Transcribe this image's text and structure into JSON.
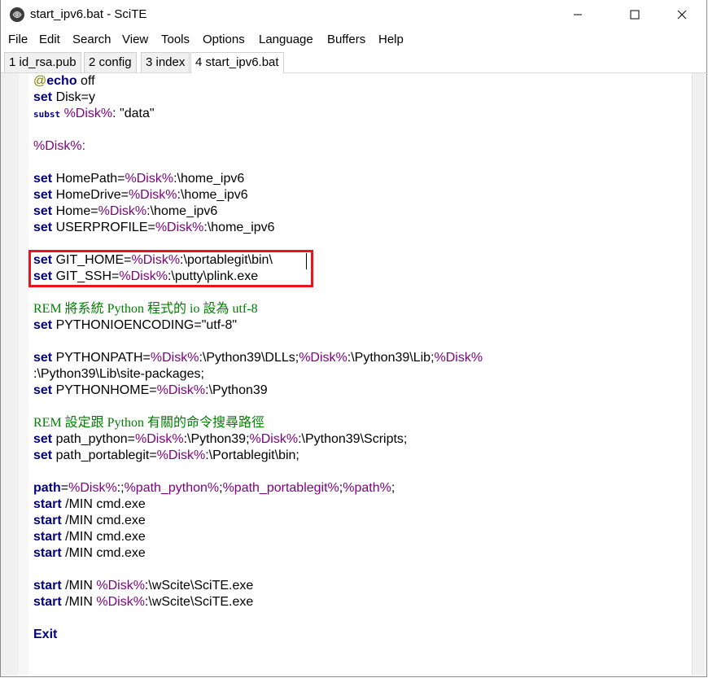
{
  "window": {
    "title": "start_ipv6.bat - SciTE",
    "controls": [
      "minimize-icon",
      "maximize-icon",
      "close-icon"
    ]
  },
  "menu": [
    "File",
    "Edit",
    "Search",
    "View",
    "Tools",
    "Options",
    "Language",
    "Buffers",
    "Help"
  ],
  "tabs": [
    {
      "label": "1 id_rsa.pub",
      "active": false
    },
    {
      "label": "2 config",
      "active": false
    },
    {
      "label": "3 index",
      "active": false
    },
    {
      "label": "4 start_ipv6.bat",
      "active": true
    }
  ],
  "editor": {
    "lines": [
      [
        {
          "t": "@",
          "c": "at"
        },
        {
          "t": "echo",
          "c": "kw"
        },
        {
          "t": " off",
          "c": ""
        }
      ],
      [
        {
          "t": "set",
          "c": "kw"
        },
        {
          "t": " Disk=y",
          "c": ""
        }
      ],
      [
        {
          "t": "subst",
          "c": "small-kw"
        },
        {
          "t": " ",
          "c": ""
        },
        {
          "t": "%Disk%",
          "c": "var"
        },
        {
          "t": ": \"data\"",
          "c": ""
        }
      ],
      [],
      [
        {
          "t": "%Disk%:",
          "c": "var"
        }
      ],
      [],
      [
        {
          "t": "set",
          "c": "kw"
        },
        {
          "t": " HomePath=",
          "c": ""
        },
        {
          "t": "%Disk%",
          "c": "var"
        },
        {
          "t": ":\\home_ipv6",
          "c": ""
        }
      ],
      [
        {
          "t": "set",
          "c": "kw"
        },
        {
          "t": " HomeDrive=",
          "c": ""
        },
        {
          "t": "%Disk%",
          "c": "var"
        },
        {
          "t": ":\\home_ipv6",
          "c": ""
        }
      ],
      [
        {
          "t": "set",
          "c": "kw"
        },
        {
          "t": " Home=",
          "c": ""
        },
        {
          "t": "%Disk%",
          "c": "var"
        },
        {
          "t": ":\\home_ipv6",
          "c": ""
        }
      ],
      [
        {
          "t": "set",
          "c": "kw"
        },
        {
          "t": " USERPROFILE=",
          "c": ""
        },
        {
          "t": "%Disk%",
          "c": "var"
        },
        {
          "t": ":\\home_ipv6",
          "c": ""
        }
      ],
      [],
      [
        {
          "t": "set",
          "c": "kw"
        },
        {
          "t": " GIT_HOME=",
          "c": ""
        },
        {
          "t": "%Disk%",
          "c": "var"
        },
        {
          "t": ":\\portablegit\\bin\\",
          "c": ""
        }
      ],
      [
        {
          "t": "set",
          "c": "kw"
        },
        {
          "t": " GIT_SSH=",
          "c": ""
        },
        {
          "t": "%Disk%",
          "c": "var"
        },
        {
          "t": ":\\putty\\plink.exe",
          "c": ""
        }
      ],
      [],
      [
        {
          "t": "REM 將系統 Python 程式的 io 設為 utf-8",
          "c": "rem"
        }
      ],
      [
        {
          "t": "set",
          "c": "kw"
        },
        {
          "t": " PYTHONIOENCODING=\"utf-8\"",
          "c": ""
        }
      ],
      [],
      [
        {
          "t": "set",
          "c": "kw"
        },
        {
          "t": " PYTHONPATH=",
          "c": ""
        },
        {
          "t": "%Disk%",
          "c": "var"
        },
        {
          "t": ":\\Python39\\DLLs;",
          "c": ""
        },
        {
          "t": "%Disk%",
          "c": "var"
        },
        {
          "t": ":\\Python39\\Lib;",
          "c": ""
        },
        {
          "t": "%Disk%",
          "c": "var"
        }
      ],
      [
        {
          "t": ":\\Python39\\Lib\\site-packages;",
          "c": ""
        }
      ],
      [
        {
          "t": "set",
          "c": "kw"
        },
        {
          "t": " PYTHONHOME=",
          "c": ""
        },
        {
          "t": "%Disk%",
          "c": "var"
        },
        {
          "t": ":\\Python39",
          "c": ""
        }
      ],
      [],
      [
        {
          "t": "REM 設定跟 Python 有關的命令搜尋路徑",
          "c": "rem"
        }
      ],
      [
        {
          "t": "set",
          "c": "kw"
        },
        {
          "t": " path_python=",
          "c": ""
        },
        {
          "t": "%Disk%",
          "c": "var"
        },
        {
          "t": ":\\Python39;",
          "c": ""
        },
        {
          "t": "%Disk%",
          "c": "var"
        },
        {
          "t": ":\\Python39\\Scripts;",
          "c": ""
        }
      ],
      [
        {
          "t": "set",
          "c": "kw"
        },
        {
          "t": " path_portablegit=",
          "c": ""
        },
        {
          "t": "%Disk%",
          "c": "var"
        },
        {
          "t": ":\\Portablegit\\bin;",
          "c": ""
        }
      ],
      [],
      [
        {
          "t": "path",
          "c": "kw"
        },
        {
          "t": "=",
          "c": ""
        },
        {
          "t": "%Disk%",
          "c": "var"
        },
        {
          "t": ":;",
          "c": ""
        },
        {
          "t": "%path_python%",
          "c": "var"
        },
        {
          "t": ";",
          "c": ""
        },
        {
          "t": "%path_portablegit%",
          "c": "var"
        },
        {
          "t": ";",
          "c": ""
        },
        {
          "t": "%path%",
          "c": "var"
        },
        {
          "t": ";",
          "c": ""
        }
      ],
      [
        {
          "t": "start",
          "c": "kw"
        },
        {
          "t": " /MIN cmd.exe",
          "c": ""
        }
      ],
      [
        {
          "t": "start",
          "c": "kw"
        },
        {
          "t": " /MIN cmd.exe",
          "c": ""
        }
      ],
      [
        {
          "t": "start",
          "c": "kw"
        },
        {
          "t": " /MIN cmd.exe",
          "c": ""
        }
      ],
      [
        {
          "t": "start",
          "c": "kw"
        },
        {
          "t": " /MIN cmd.exe",
          "c": ""
        }
      ],
      [],
      [
        {
          "t": "start",
          "c": "kw"
        },
        {
          "t": " /MIN ",
          "c": ""
        },
        {
          "t": "%Disk%",
          "c": "var"
        },
        {
          "t": ":\\wScite\\SciTE.exe",
          "c": ""
        }
      ],
      [
        {
          "t": "start",
          "c": "kw"
        },
        {
          "t": " /MIN ",
          "c": ""
        },
        {
          "t": "%Disk%",
          "c": "var"
        },
        {
          "t": ":\\wScite\\SciTE.exe",
          "c": ""
        }
      ],
      [],
      [
        {
          "t": "Exit",
          "c": "kw"
        }
      ]
    ]
  },
  "colors": {
    "keyword": "#00007f",
    "variable": "#7f007f",
    "comment": "#007f00",
    "highlight_box": "#e8131b"
  }
}
